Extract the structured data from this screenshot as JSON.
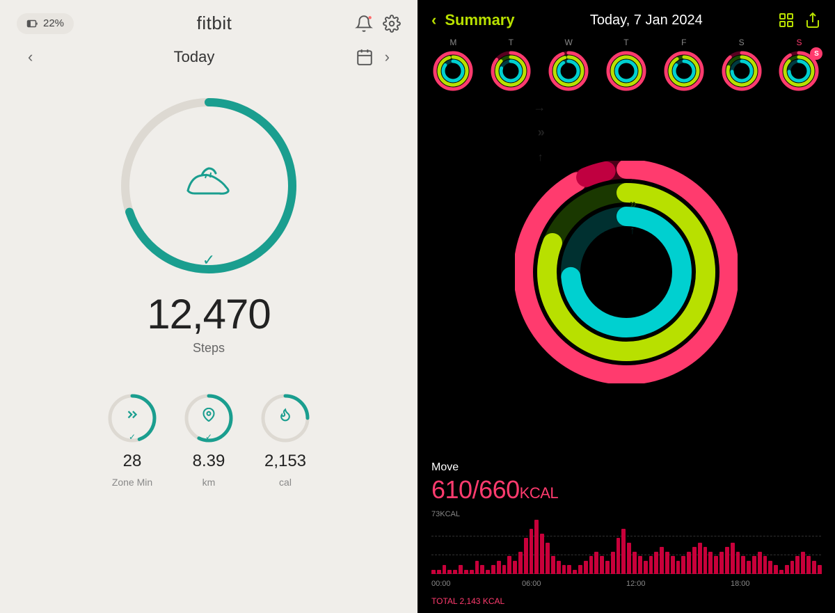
{
  "fitbit": {
    "battery": "22%",
    "logo": "fitbit",
    "nav": {
      "prev": "<",
      "next": ">",
      "today": "Today"
    },
    "steps": {
      "count": "12,470",
      "label": "Steps"
    },
    "metrics": [
      {
        "value": "28",
        "label": "Zone Min",
        "icon": "⚡"
      },
      {
        "value": "8.39",
        "label": "km",
        "icon": "📍"
      },
      {
        "value": "2,153",
        "label": "cal",
        "icon": "🔥"
      }
    ]
  },
  "apple": {
    "back_label": "Summary",
    "date": "Today, 7 Jan 2024",
    "week_days": [
      "M",
      "T",
      "W",
      "T",
      "F",
      "S",
      "S"
    ],
    "active_day": 6,
    "rings": {
      "move_color": "#ff3b6e",
      "exercise_color": "#b8e000",
      "stand_color": "#00d0d0"
    },
    "move": {
      "label": "Move",
      "current": "610",
      "goal": "660",
      "unit": "KCAL"
    },
    "chart": {
      "y_max": "73KCAL",
      "x_labels": [
        "00:00",
        "06:00",
        "12:00",
        "18:00"
      ],
      "total": "TOTAL 2,143 KCAL",
      "bars": [
        1,
        1,
        2,
        1,
        1,
        2,
        1,
        1,
        3,
        2,
        1,
        2,
        3,
        2,
        4,
        3,
        5,
        8,
        10,
        12,
        9,
        7,
        4,
        3,
        2,
        2,
        1,
        2,
        3,
        4,
        5,
        4,
        3,
        5,
        8,
        10,
        7,
        5,
        4,
        3,
        4,
        5,
        6,
        5,
        4,
        3,
        4,
        5,
        6,
        7,
        6,
        5,
        4,
        5,
        6,
        7,
        5,
        4,
        3,
        4,
        5,
        4,
        3,
        2,
        1,
        2,
        3,
        4,
        5,
        4,
        3,
        2
      ]
    }
  }
}
